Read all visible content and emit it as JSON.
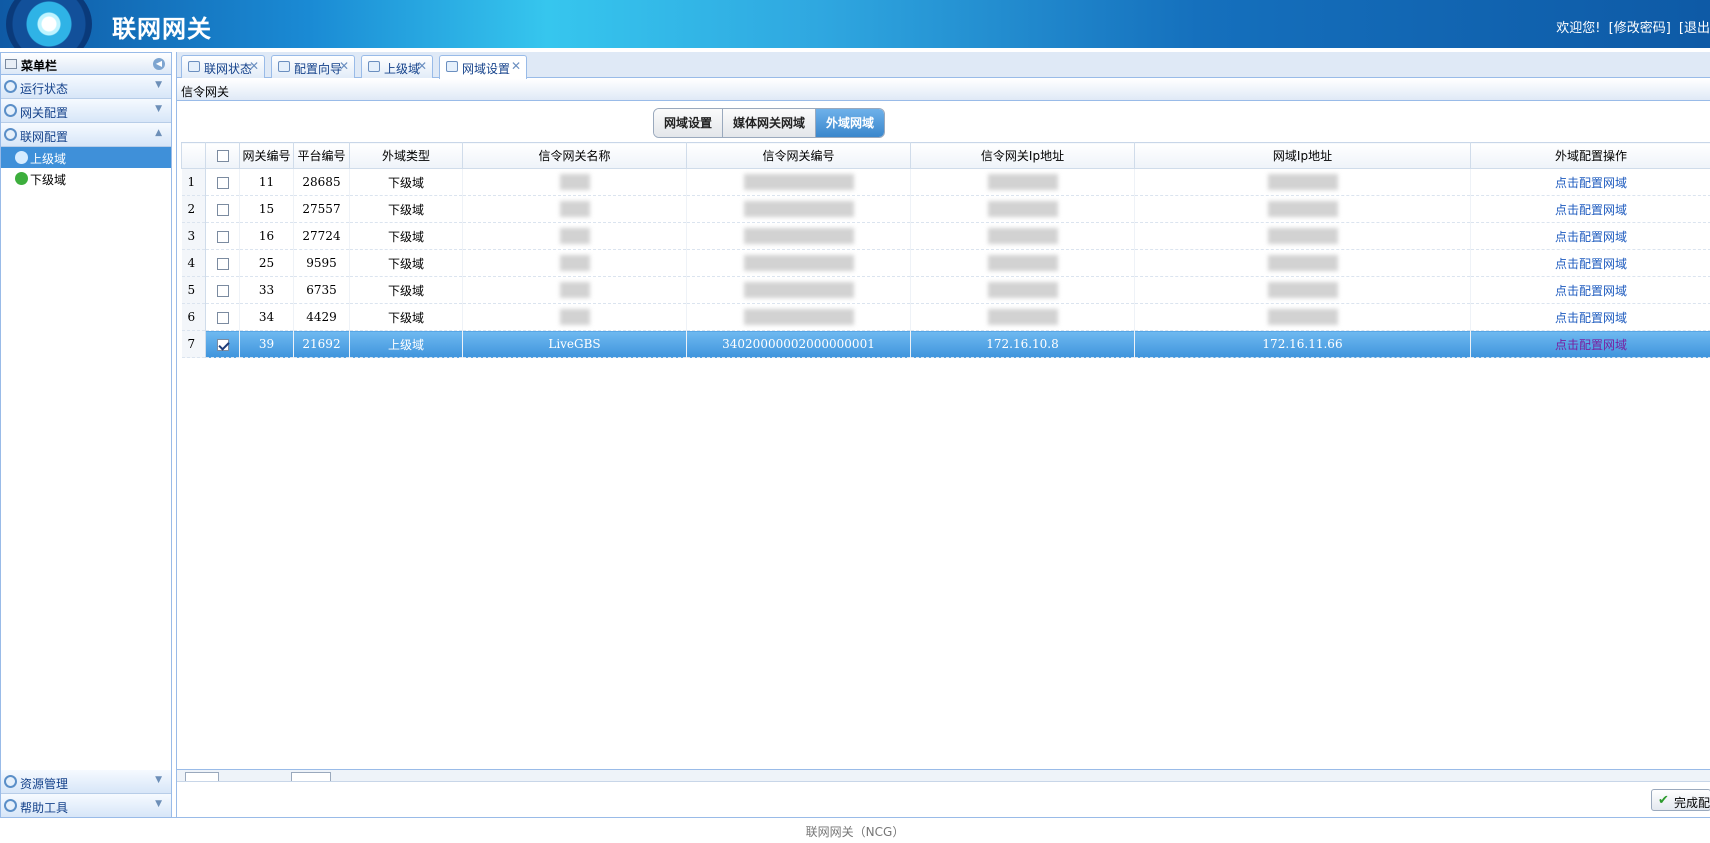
{
  "header": {
    "app_title": "联网网关",
    "welcome": "欢迎您!",
    "change_password": "[修改密码]",
    "logout": "[退出"
  },
  "sidebar": {
    "menu_title": "菜单栏",
    "sections": [
      {
        "label": "运行状态"
      },
      {
        "label": "网关配置"
      },
      {
        "label": "联网配置"
      }
    ],
    "subitems": [
      {
        "label": "上级域"
      },
      {
        "label": "下级域"
      }
    ],
    "bottom_sections": [
      {
        "label": "资源管理"
      },
      {
        "label": "帮助工具"
      }
    ]
  },
  "tabs": [
    {
      "label": "联网状态"
    },
    {
      "label": "配置向导"
    },
    {
      "label": "上级域"
    },
    {
      "label": "网域设置"
    }
  ],
  "panel": {
    "title": "信令网关"
  },
  "switch": {
    "options": [
      "网域设置",
      "媒体网关网域",
      "外域网域"
    ],
    "selected": "外域网域"
  },
  "grid": {
    "headers": [
      "网关编号",
      "平台编号",
      "外域类型",
      "信令网关名称",
      "信令网关编号",
      "信令网关Ip地址",
      "网域Ip地址",
      "外域配置操作"
    ],
    "rows": [
      {
        "n": "1",
        "gw": "11",
        "plat": "28685",
        "type": "下级域",
        "name": "",
        "code": "",
        "ip": "",
        "dip": "",
        "op": "点击配置网域",
        "checked": false
      },
      {
        "n": "2",
        "gw": "15",
        "plat": "27557",
        "type": "下级域",
        "name": "",
        "code": "",
        "ip": "",
        "dip": "",
        "op": "点击配置网域",
        "checked": false
      },
      {
        "n": "3",
        "gw": "16",
        "plat": "27724",
        "type": "下级域",
        "name": "",
        "code": "",
        "ip": "",
        "dip": "",
        "op": "点击配置网域",
        "checked": false
      },
      {
        "n": "4",
        "gw": "25",
        "plat": "9595",
        "type": "下级域",
        "name": "",
        "code": "",
        "ip": "",
        "dip": "",
        "op": "点击配置网域",
        "checked": false
      },
      {
        "n": "5",
        "gw": "33",
        "plat": "6735",
        "type": "下级域",
        "name": "",
        "code": "",
        "ip": "",
        "dip": "",
        "op": "点击配置网域",
        "checked": false
      },
      {
        "n": "6",
        "gw": "34",
        "plat": "4429",
        "type": "下级域",
        "name": "",
        "code": "",
        "ip": "",
        "dip": "",
        "op": "点击配置网域",
        "checked": false
      },
      {
        "n": "7",
        "gw": "39",
        "plat": "21692",
        "type": "上级域",
        "name": "LiveGBS",
        "code": "34020000002000000001",
        "ip": "172.16.10.8",
        "dip": "172.16.11.66",
        "op": "点击配置网域",
        "checked": true
      }
    ]
  },
  "actions": {
    "done": "完成配"
  },
  "footer": {
    "text": "联网网关（NCG）"
  }
}
